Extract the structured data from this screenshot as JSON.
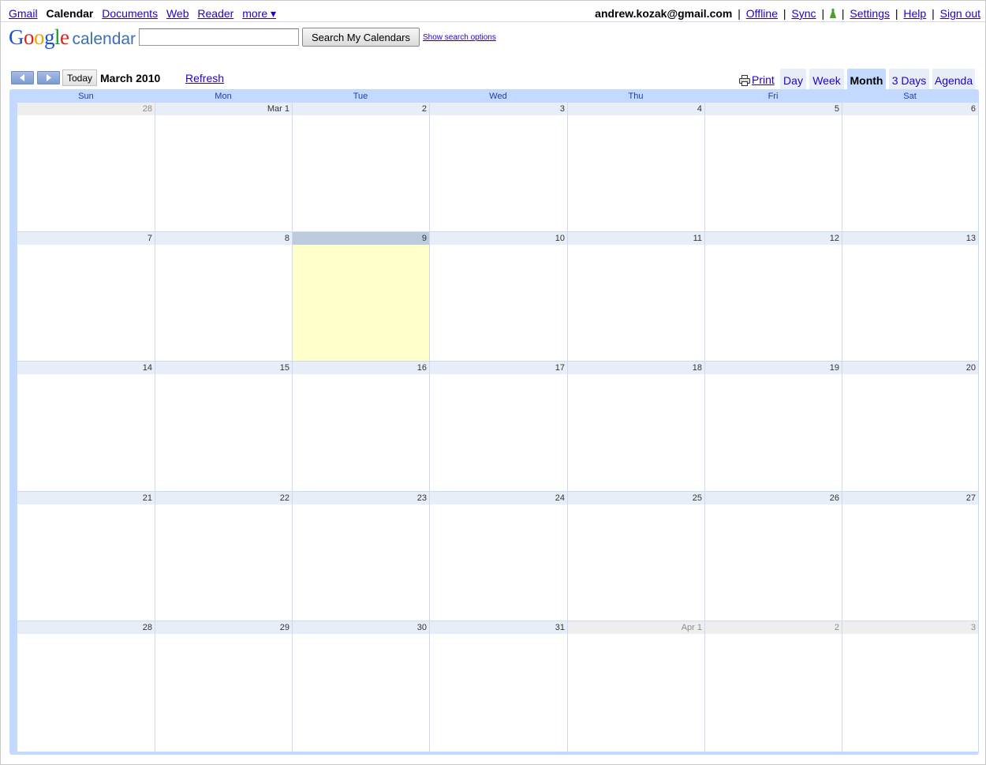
{
  "topbar": {
    "links": [
      "Gmail",
      "Calendar",
      "Documents",
      "Web",
      "Reader",
      "more ▾"
    ],
    "current_index": 1,
    "user_email": "andrew.kozak@gmail.com",
    "right_links": {
      "offline": "Offline",
      "sync": "Sync",
      "settings": "Settings",
      "help": "Help",
      "signout": "Sign out"
    },
    "separator": "|"
  },
  "logo": {
    "google": [
      "G",
      "o",
      "o",
      "g",
      "l",
      "e"
    ],
    "product": "calendar"
  },
  "search": {
    "value": "",
    "button_label": "Search My Calendars",
    "options_link": "Show search options"
  },
  "toolbar": {
    "today_label": "Today",
    "period_title": "March 2010",
    "refresh_label": "Refresh",
    "print_label": "Print"
  },
  "view_tabs": {
    "day": "Day",
    "week": "Week",
    "month": "Month",
    "three_days": "3 Days",
    "agenda": "Agenda",
    "selected": "Month"
  },
  "weekdays": [
    "Sun",
    "Mon",
    "Tue",
    "Wed",
    "Thu",
    "Fri",
    "Sat"
  ],
  "weeks": [
    [
      {
        "label": "28",
        "other": true
      },
      {
        "label": "Mar 1"
      },
      {
        "label": "2"
      },
      {
        "label": "3"
      },
      {
        "label": "4"
      },
      {
        "label": "5"
      },
      {
        "label": "6"
      }
    ],
    [
      {
        "label": "7"
      },
      {
        "label": "8"
      },
      {
        "label": "9",
        "today": true
      },
      {
        "label": "10"
      },
      {
        "label": "11"
      },
      {
        "label": "12"
      },
      {
        "label": "13"
      }
    ],
    [
      {
        "label": "14"
      },
      {
        "label": "15"
      },
      {
        "label": "16"
      },
      {
        "label": "17"
      },
      {
        "label": "18"
      },
      {
        "label": "19"
      },
      {
        "label": "20"
      }
    ],
    [
      {
        "label": "21"
      },
      {
        "label": "22"
      },
      {
        "label": "23"
      },
      {
        "label": "24"
      },
      {
        "label": "25"
      },
      {
        "label": "26"
      },
      {
        "label": "27"
      }
    ],
    [
      {
        "label": "28"
      },
      {
        "label": "29"
      },
      {
        "label": "30"
      },
      {
        "label": "31"
      },
      {
        "label": "Apr 1",
        "other": true
      },
      {
        "label": "2",
        "other": true
      },
      {
        "label": "3",
        "other": true
      }
    ]
  ],
  "colors": {
    "link": "#2200cc",
    "frame": "#c3d9ff",
    "today_fill": "#ffffcc",
    "day_header": "#e8eef7",
    "labs_icon": "#4aa02c"
  },
  "icons": {
    "labs": "flask-icon",
    "print": "printer-icon",
    "prev": "triangle-left-icon",
    "next": "triangle-right-icon"
  }
}
